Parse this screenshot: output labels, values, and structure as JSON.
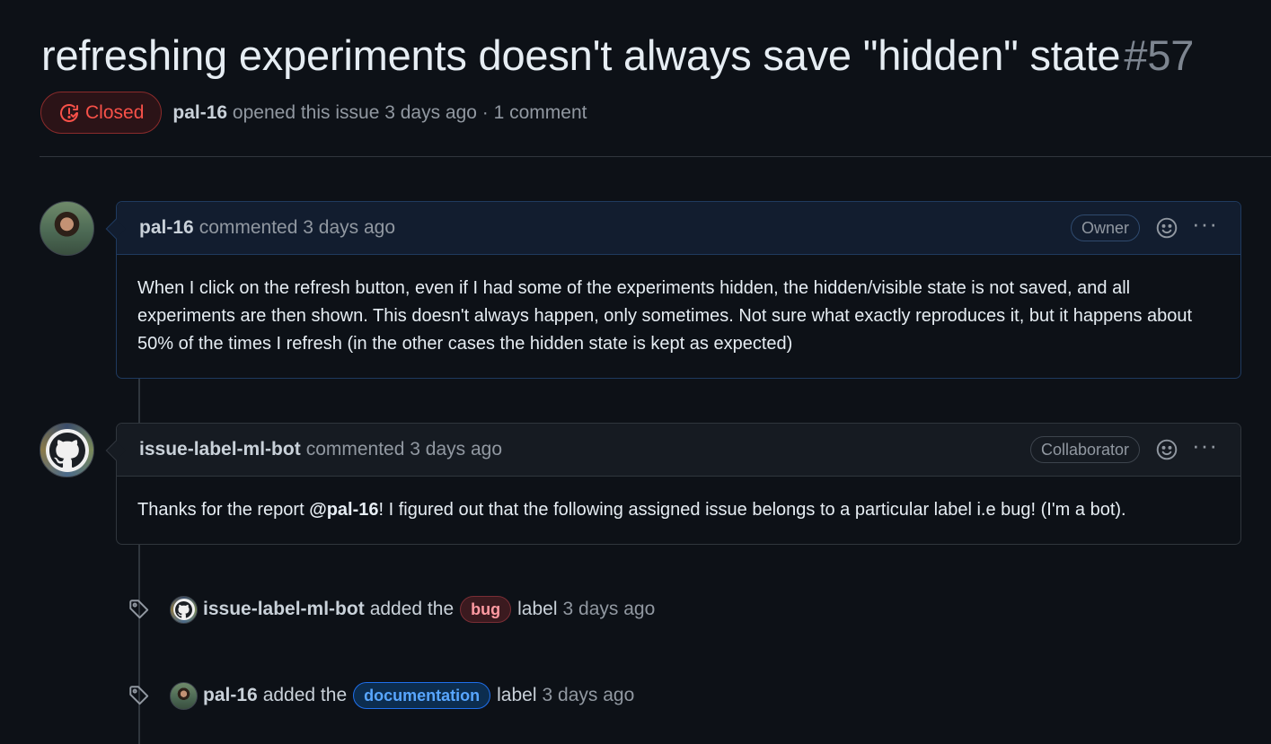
{
  "issue": {
    "title": "refreshing experiments doesn't always save \"hidden\" state",
    "number": "#57",
    "state": "Closed",
    "author": "pal-16",
    "opened_text": "opened this issue 3 days ago · 1 comment"
  },
  "comments": [
    {
      "author": "pal-16",
      "action": "commented 3 days ago",
      "role": "Owner",
      "body": "When I click on the refresh button, even if I had some of the experiments hidden, the hidden/visible state is not saved, and all experiments are then shown. This doesn't always happen, only sometimes. Not sure what exactly reproduces it, but it happens about 50% of the times I refresh (in the other cases the hidden state is kept as expected)"
    },
    {
      "author": "issue-label-ml-bot",
      "action": "commented 3 days ago",
      "role": "Collaborator",
      "body_prefix": "Thanks for the report ",
      "body_mention": "@pal-16",
      "body_suffix": "! I figured out that the following assigned issue belongs to a particular label i.e bug! (I'm a bot)."
    }
  ],
  "events": [
    {
      "actor": "issue-label-ml-bot",
      "action": "added the",
      "label": "bug",
      "suffix": "label",
      "time": "3 days ago"
    },
    {
      "actor": "pal-16",
      "action": "added the",
      "label": "documentation",
      "suffix": "label",
      "time": "3 days ago"
    }
  ],
  "colors": {
    "closed": "#f85149",
    "background": "#0d1117",
    "label_bug": "#ff9aa2",
    "label_documentation": "#58a6ff"
  },
  "icons": [
    "issue-closed-icon",
    "smiley-icon",
    "kebab-icon",
    "tag-icon",
    "github-octocat-icon"
  ]
}
